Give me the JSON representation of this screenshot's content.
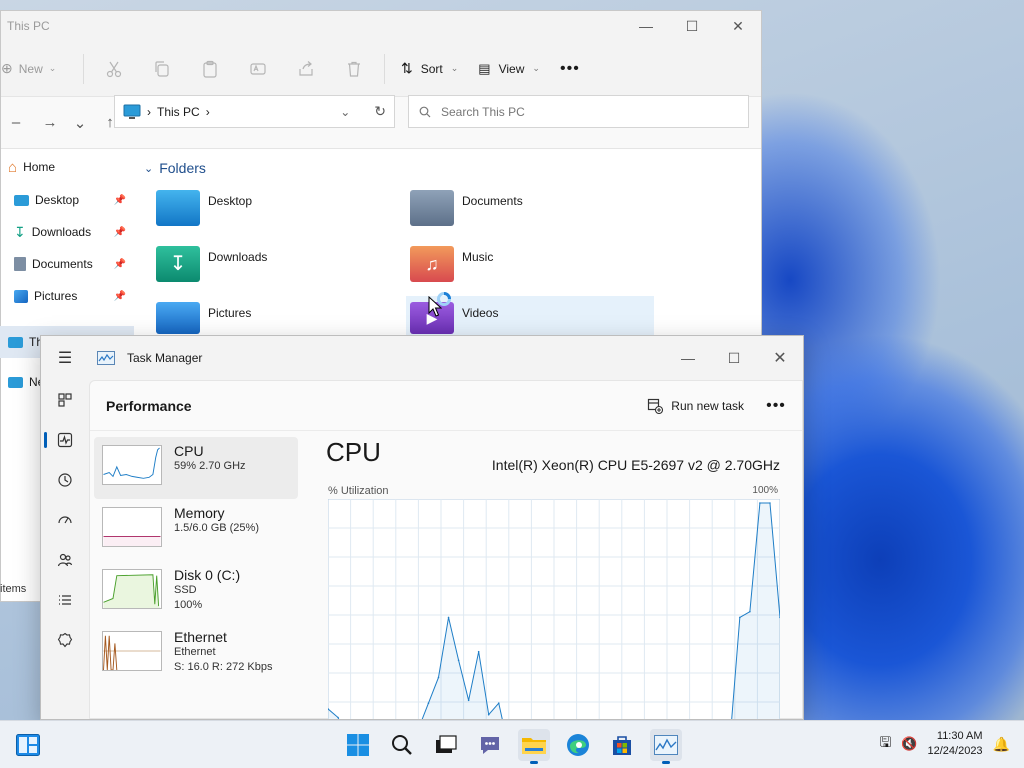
{
  "explorer": {
    "title": "This PC",
    "toolbar": {
      "new_label": "New",
      "sort_label": "Sort",
      "view_label": "View"
    },
    "address": {
      "location": "This PC"
    },
    "search": {
      "placeholder": "Search This PC"
    },
    "sidebar": [
      {
        "label": "Home"
      },
      {
        "label": "Desktop"
      },
      {
        "label": "Downloads"
      },
      {
        "label": "Documents"
      },
      {
        "label": "Pictures"
      },
      {
        "label": "Th"
      },
      {
        "label": "Ne"
      }
    ],
    "section_label": "Folders",
    "folders": [
      {
        "label": "Desktop",
        "color": "#1e90d8"
      },
      {
        "label": "Documents",
        "color": "#6d8199"
      },
      {
        "label": "Downloads",
        "color": "#13a085"
      },
      {
        "label": "Music",
        "color": "#e8683d"
      },
      {
        "label": "Pictures",
        "color": "#1e88e5"
      },
      {
        "label": "Videos",
        "color": "#7b3fbf"
      }
    ],
    "status_items": "items"
  },
  "task_manager": {
    "title": "Task Manager",
    "page_title": "Performance",
    "run_new_task": "Run new task",
    "resources": [
      {
        "name": "CPU",
        "line1": "59%  2.70 GHz",
        "line2": ""
      },
      {
        "name": "Memory",
        "line1": "1.5/6.0 GB (25%)",
        "line2": ""
      },
      {
        "name": "Disk 0 (C:)",
        "line1": "SSD",
        "line2": "100%"
      },
      {
        "name": "Ethernet",
        "line1": "Ethernet",
        "line2": "S: 16.0  R: 272 Kbps"
      }
    ],
    "detail": {
      "title": "CPU",
      "model": "Intel(R) Xeon(R) CPU E5-2697 v2 @ 2.70GHz",
      "y_label": "% Utilization",
      "y_max_label": "100%"
    },
    "accent_color": "#005fb8"
  },
  "chart_data": {
    "type": "line",
    "title": "CPU",
    "ylabel": "% Utilization",
    "ylim": [
      0,
      100
    ],
    "grid": true,
    "series": [
      {
        "values": [
          28,
          25,
          17,
          20,
          21,
          21,
          20,
          22,
          17,
          21,
          30,
          39,
          60,
          45,
          31,
          48,
          26,
          30,
          14,
          9,
          11,
          10,
          12,
          8,
          6,
          5,
          6,
          12,
          6,
          8,
          7,
          5,
          5,
          4,
          5,
          5,
          6,
          9,
          5,
          5,
          16,
          60,
          62,
          100,
          100,
          60
        ]
      }
    ]
  },
  "taskbar": {
    "time": "11:30 AM",
    "date": "12/24/2023"
  }
}
